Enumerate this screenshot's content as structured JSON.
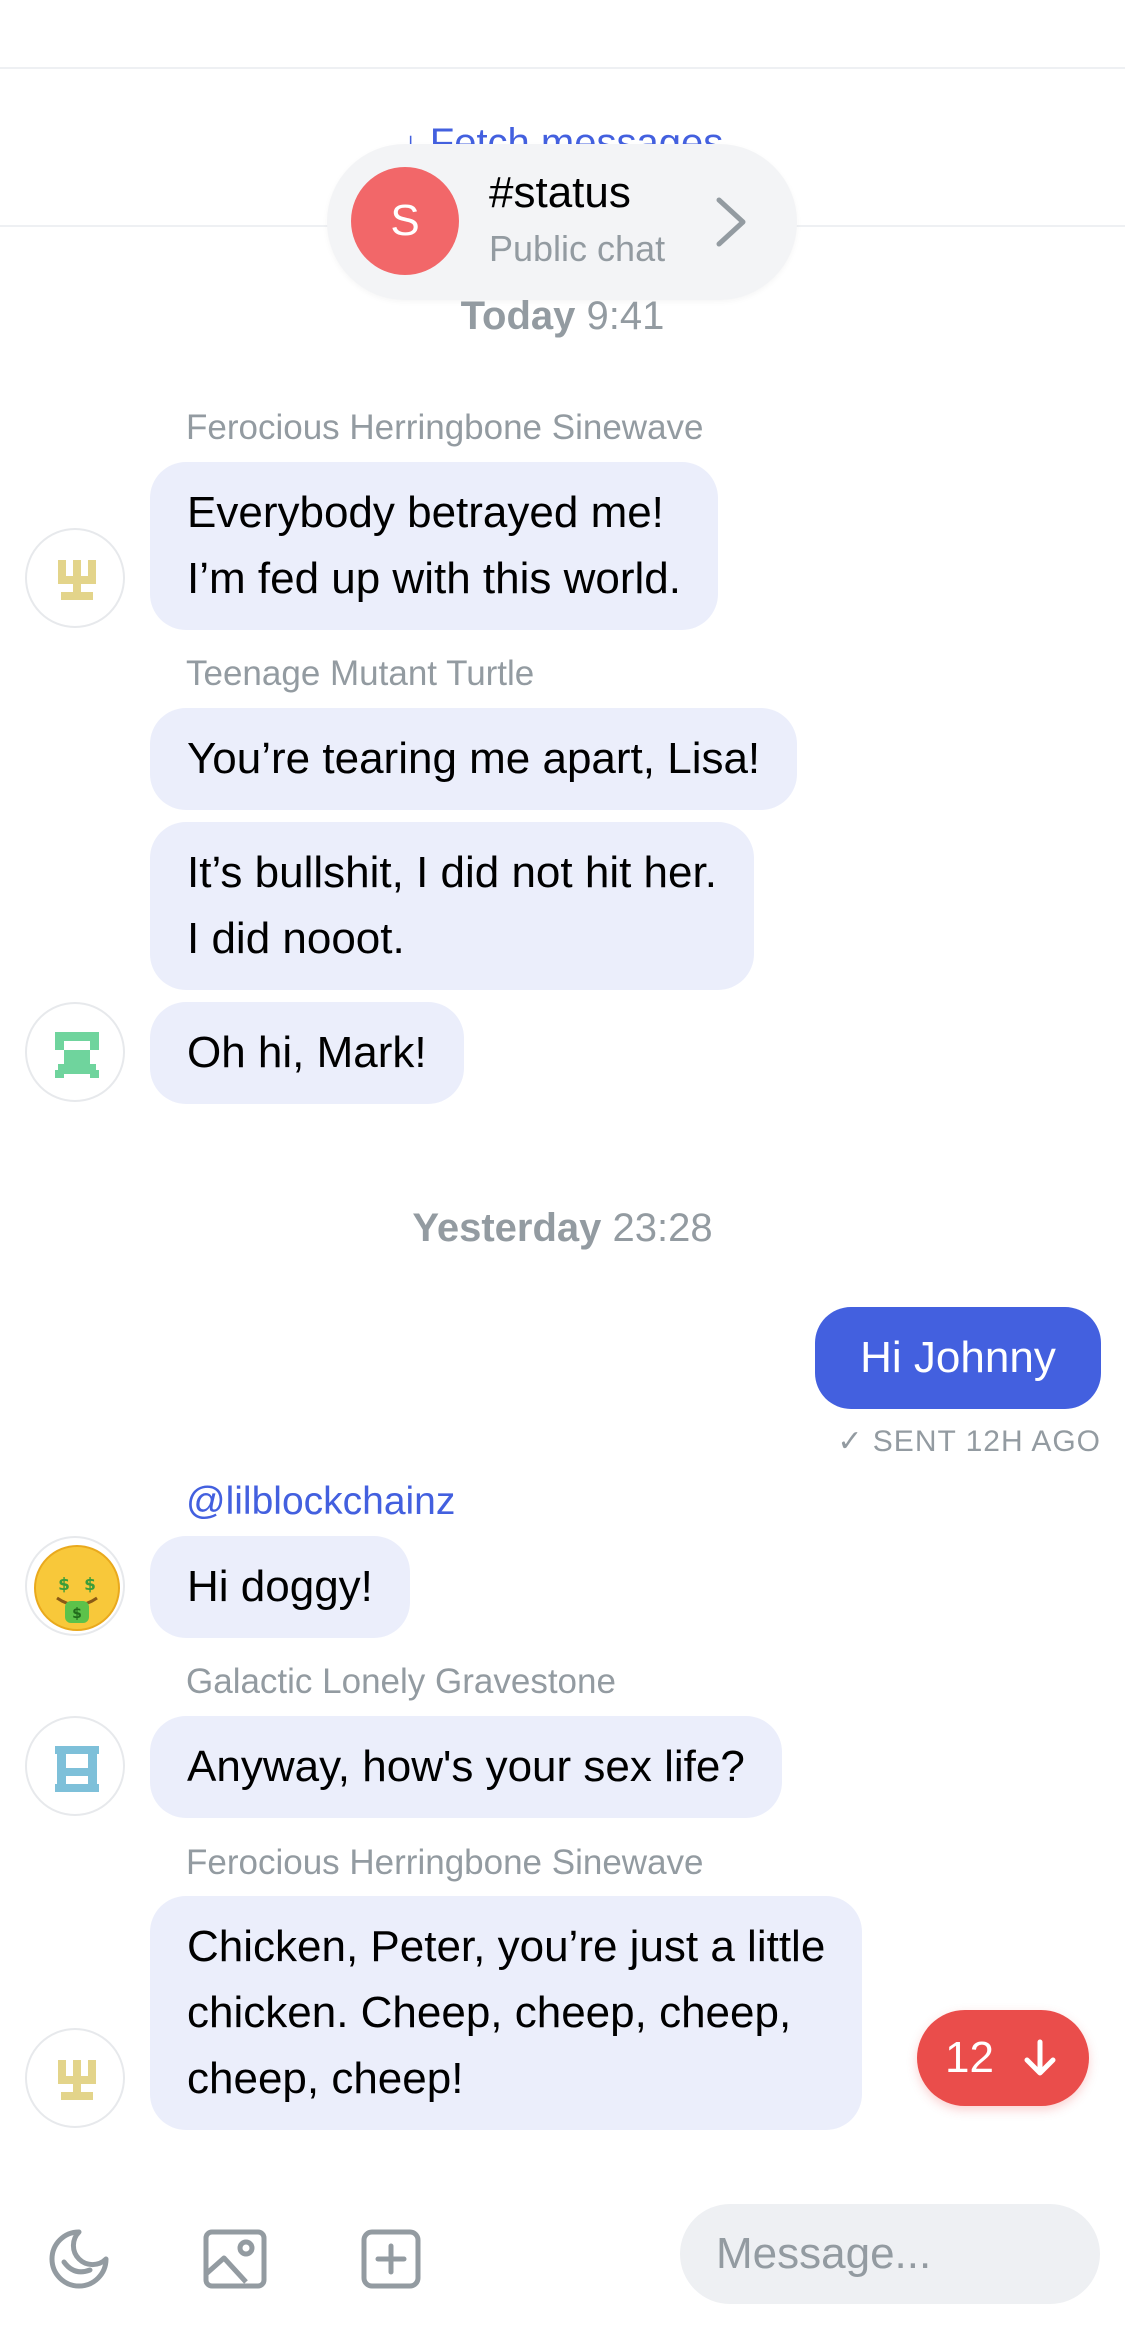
{
  "fetch": {
    "label": "Fetch messages",
    "icon": "arrow-down-icon"
  },
  "chat_header": {
    "avatar_letter": "S",
    "title": "#status",
    "subtitle": "Public chat",
    "accent": "#f26769"
  },
  "timestamps": {
    "today": {
      "day": "Today",
      "time": "9:41"
    },
    "yesterday": {
      "day": "Yesterday",
      "time": "23:28"
    }
  },
  "messages": [
    {
      "sender": "Ferocious Herringbone Sinewave",
      "lines": [
        "Everybody betrayed me!",
        "I’m fed up with this world."
      ]
    },
    {
      "sender": "Teenage Mutant Turtle",
      "lines": [
        "You’re tearing me apart, Lisa!"
      ]
    },
    {
      "lines": [
        "It’s bullshit, I did not hit her.",
        "I did nooot."
      ]
    },
    {
      "lines": [
        "Oh hi, Mark!"
      ]
    },
    {
      "outgoing": true,
      "lines": [
        "Hi Johnny"
      ],
      "status": "SENT 12H AGO"
    },
    {
      "sender": "@lilblockchainz",
      "lines": [
        "Hi doggy!"
      ]
    },
    {
      "sender": "Galactic Lonely Gravestone",
      "lines": [
        "Anyway, how's your sex life?"
      ]
    },
    {
      "sender": "Ferocious Herringbone Sinewave",
      "lines": [
        "Chicken, Peter, you’re just a little",
        "chicken. Cheep, cheep, cheep,",
        "cheep, cheep!"
      ]
    }
  ],
  "unread": {
    "count": "12"
  },
  "composer": {
    "placeholder": "Message..."
  },
  "colors": {
    "brand": "#4360df",
    "bubble_in": "#ebeefb",
    "badge": "#ea4d4b",
    "muted": "#939ba1"
  }
}
